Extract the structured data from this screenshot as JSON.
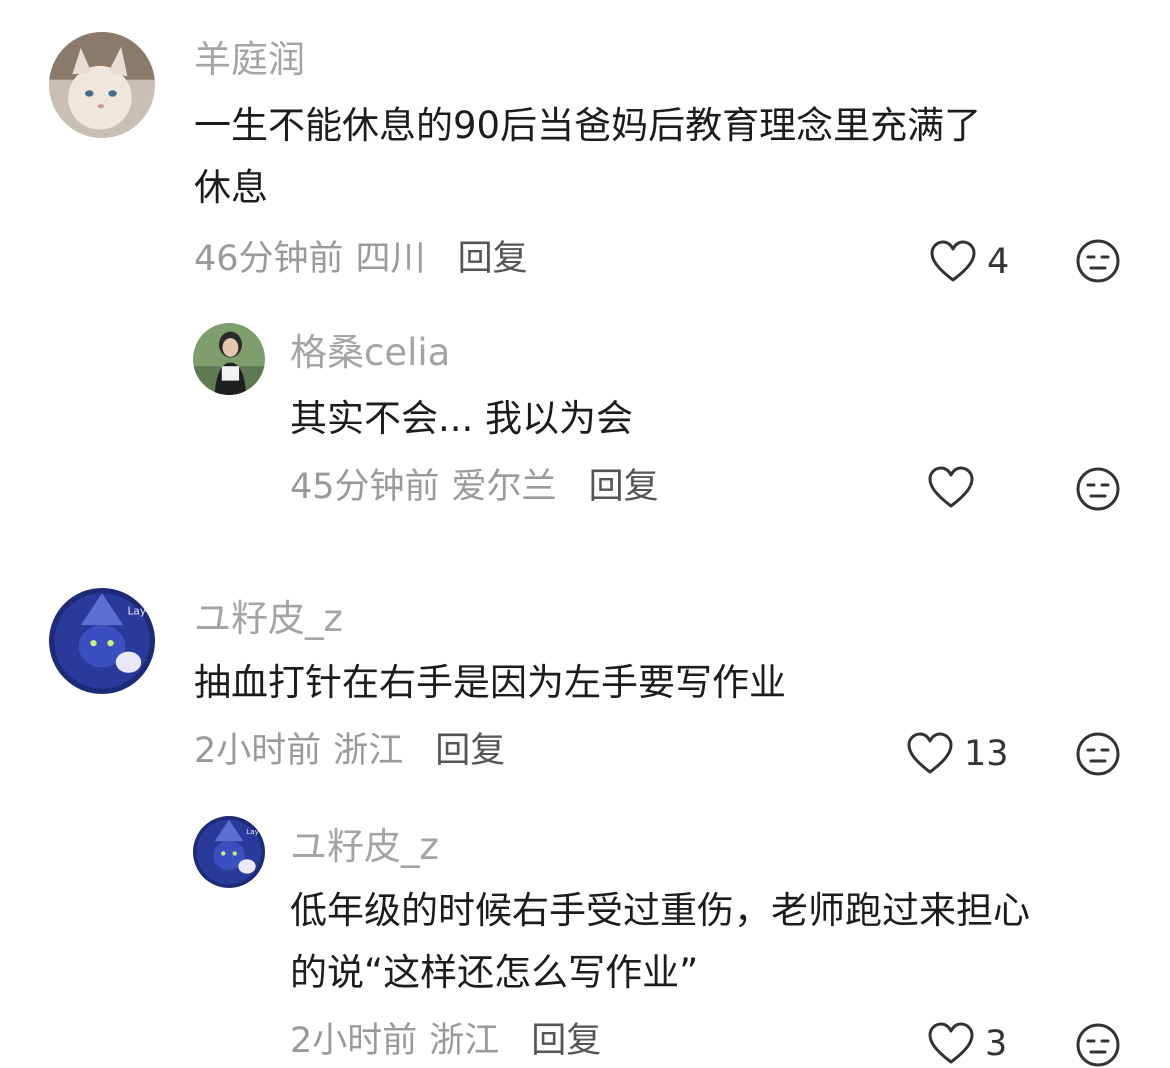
{
  "comments": [
    {
      "username": "羊庭润",
      "text": "一生不能休息的90后当爸妈后教育理念里充满了\n休息",
      "time": "46分钟前",
      "location": "四川",
      "reply_label": "回复",
      "likes": "4",
      "avatar": "cat-avatar",
      "replies": [
        {
          "username": "格桑celia",
          "text": "其实不会... 我以为会",
          "time": "45分钟前",
          "location": "爱尔兰",
          "reply_label": "回复",
          "likes": "",
          "avatar": "woman-photo-avatar"
        }
      ]
    },
    {
      "username": "ユ籽皮_z",
      "text": "抽血打针在右手是因为左手要写作业",
      "time": "2小时前",
      "location": "浙江",
      "reply_label": "回复",
      "likes": "13",
      "avatar": "blue-cartoon-avatar",
      "replies": [
        {
          "username": "ユ籽皮_z",
          "text": "低年级的时候右手受过重伤，老师跑过来担心\n的说“这样还怎么写作业”",
          "time": "2小时前",
          "location": "浙江",
          "reply_label": "回复",
          "likes": "3",
          "avatar": "blue-cartoon-avatar"
        }
      ]
    }
  ],
  "colors": {
    "username": "#a4a4a4",
    "text": "#1c1c1c",
    "meta": "#9a9a9a",
    "reply": "#555555",
    "icon": "#333333"
  },
  "icons": {
    "like": "heart-outline-icon",
    "emoji": "neutral-face-icon"
  }
}
